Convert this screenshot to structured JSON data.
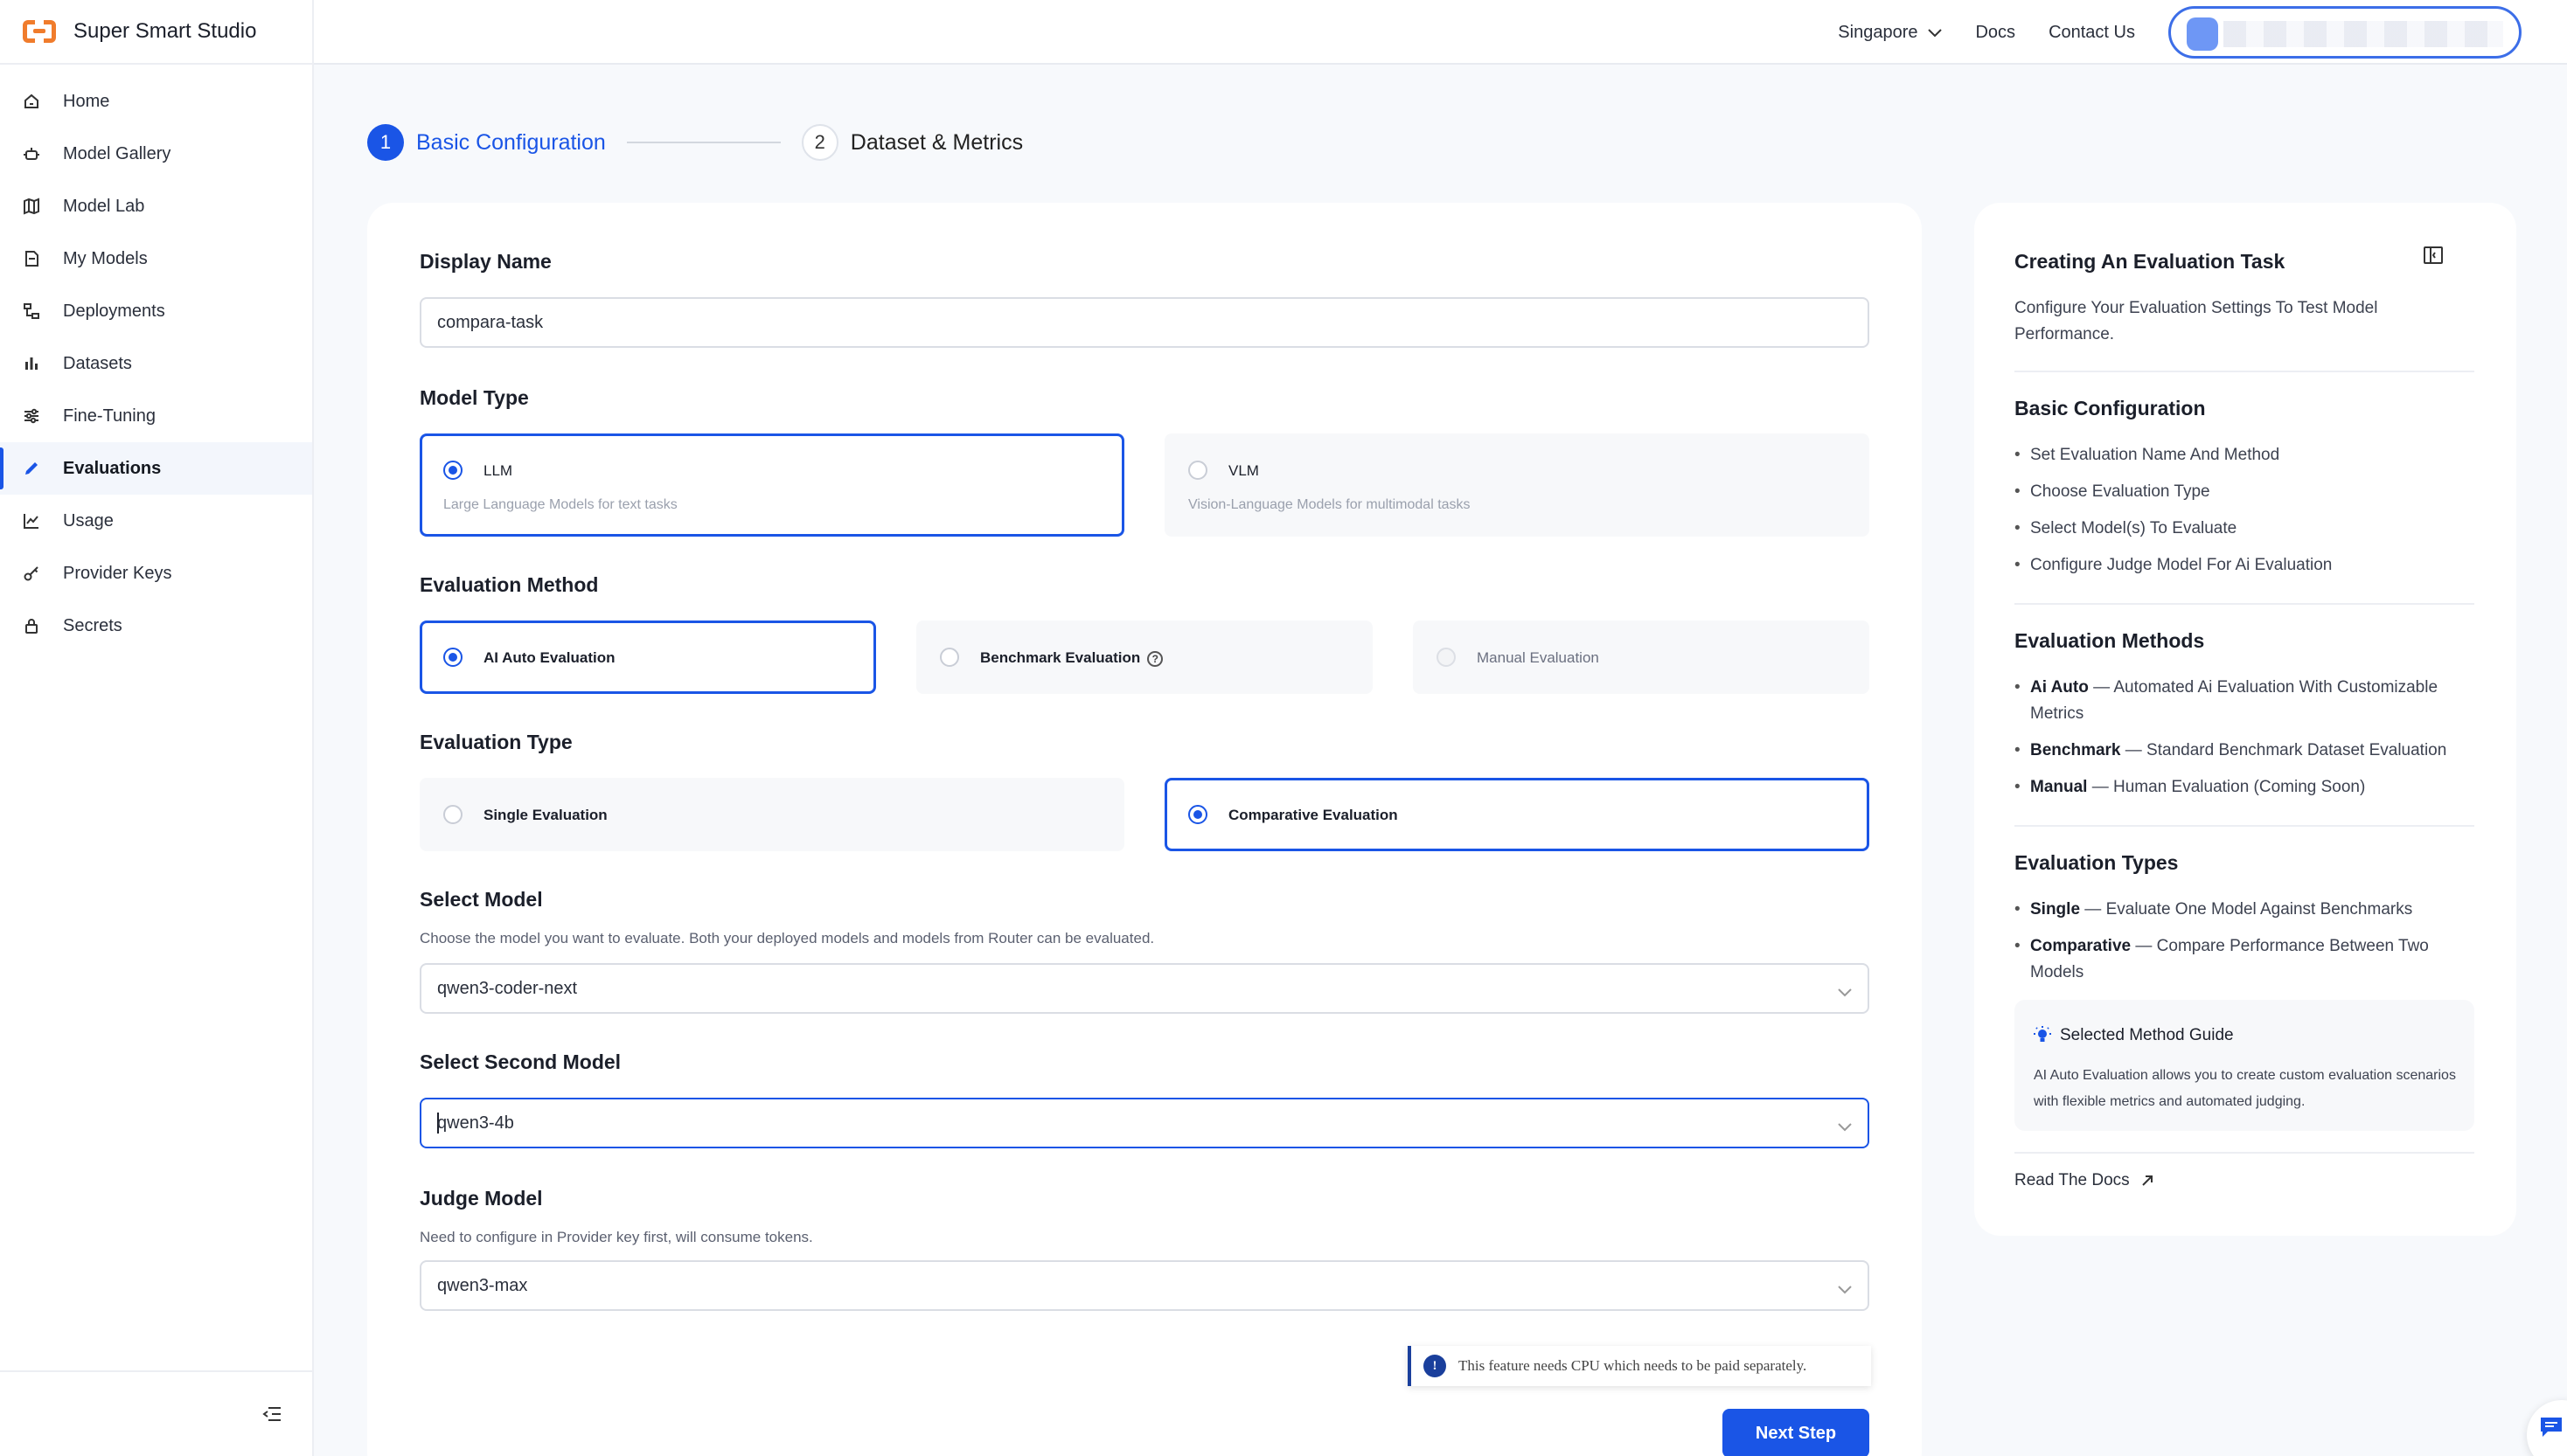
{
  "app": {
    "name": "Super Smart Studio"
  },
  "sidebar": {
    "items": [
      {
        "label": "Home",
        "icon": "home-icon"
      },
      {
        "label": "Model Gallery",
        "icon": "robot-icon"
      },
      {
        "label": "Model Lab",
        "icon": "map-icon"
      },
      {
        "label": "My Models",
        "icon": "cube-doc-icon"
      },
      {
        "label": "Deployments",
        "icon": "hierarchy-icon"
      },
      {
        "label": "Datasets",
        "icon": "bar-chart-icon"
      },
      {
        "label": "Fine-Tuning",
        "icon": "sliders-icon"
      },
      {
        "label": "Evaluations",
        "icon": "pen-icon",
        "active": true
      },
      {
        "label": "Usage",
        "icon": "line-chart-icon"
      },
      {
        "label": "Provider Keys",
        "icon": "key-icon"
      },
      {
        "label": "Secrets",
        "icon": "lock-icon"
      }
    ]
  },
  "header": {
    "region": "Singapore",
    "links": [
      "Docs",
      "Contact Us"
    ]
  },
  "stepper": {
    "steps": [
      {
        "number": "1",
        "label": "Basic Configuration",
        "active": true
      },
      {
        "number": "2",
        "label": "Dataset & Metrics",
        "active": false
      }
    ]
  },
  "form": {
    "display_name": {
      "label": "Display Name",
      "value": "compara-task"
    },
    "model_type": {
      "label": "Model Type",
      "options": [
        {
          "title": "LLM",
          "desc": "Large Language Models for text tasks",
          "selected": true
        },
        {
          "title": "VLM",
          "desc": "Vision-Language Models for multimodal tasks",
          "selected": false
        }
      ]
    },
    "evaluation_method": {
      "label": "Evaluation Method",
      "options": [
        {
          "title": "AI Auto Evaluation",
          "selected": true
        },
        {
          "title": "Benchmark Evaluation",
          "selected": false
        },
        {
          "title": "Manual Evaluation",
          "selected": false,
          "disabled": true
        }
      ]
    },
    "evaluation_type": {
      "label": "Evaluation Type",
      "options": [
        {
          "title": "Single Evaluation",
          "selected": false
        },
        {
          "title": "Comparative Evaluation",
          "selected": true
        }
      ]
    },
    "select_model": {
      "label": "Select Model",
      "hint": "Choose the model you want to evaluate. Both your deployed models and models from Router can be evaluated.",
      "value": "qwen3-coder-next"
    },
    "second_model": {
      "label": "Select Second Model",
      "value": "qwen3-4b"
    },
    "judge_model": {
      "label": "Judge Model",
      "hint": "Need to configure in Provider key first, will consume tokens.",
      "value": "qwen3-max"
    },
    "notice": "This feature needs CPU which needs to be paid separately.",
    "next_label": "Next Step"
  },
  "help": {
    "title": "Creating An Evaluation Task",
    "intro": "Configure Your Evaluation Settings To Test Model Performance.",
    "basic": {
      "heading": "Basic Configuration",
      "items": [
        "Set Evaluation Name And Method",
        "Choose Evaluation Type",
        "Select Model(s) To Evaluate",
        "Configure Judge Model For Ai Evaluation"
      ]
    },
    "methods": {
      "heading": "Evaluation Methods",
      "items": [
        {
          "term": "Ai Auto",
          "text": " — Automated Ai Evaluation With Customizable Metrics"
        },
        {
          "term": "Benchmark",
          "text": " — Standard Benchmark Dataset Evaluation"
        },
        {
          "term": "Manual",
          "text": " — Human Evaluation (Coming Soon)"
        }
      ]
    },
    "types": {
      "heading": "Evaluation Types",
      "items": [
        {
          "term": "Single",
          "text": " — Evaluate One Model Against Benchmarks"
        },
        {
          "term": "Comparative",
          "text": " — Compare Performance Between Two Models"
        }
      ]
    },
    "guide": {
      "title": "Selected Method Guide",
      "text": "AI Auto Evaluation allows you to create custom evaluation scenarios with flexible metrics and automated judging."
    },
    "docs_label": "Read The Docs"
  },
  "colors": {
    "accent": "#1a55e6",
    "brand": "#f07c2c"
  }
}
